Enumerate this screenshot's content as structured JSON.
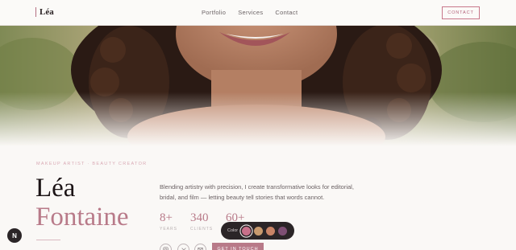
{
  "nav": {
    "logo": "Léa",
    "links": [
      "Portfolio",
      "Services",
      "Contact"
    ],
    "contact_button": "CONTACT"
  },
  "hero": {
    "eyebrow": "MAKEUP ARTIST · BEAUTY CREATOR",
    "first_name": "Léa",
    "last_name": "Fontaine",
    "bio": "Blending artistry with precision, I create transformative looks for editorial, bridal, and film — letting beauty tell stories that words cannot.",
    "stats": [
      {
        "value": "8+",
        "label": "YEARS"
      },
      {
        "value": "340",
        "label": "CLIENTS"
      },
      {
        "value": "60+",
        "label": ""
      }
    ],
    "cta": "GET IN TOUCH",
    "social_icons": [
      "instagram-icon",
      "x-icon",
      "mail-icon"
    ]
  },
  "palette": {
    "label": "Color",
    "swatches": [
      "#c9708a",
      "#c89a6e",
      "#c98466",
      "#7e4f74"
    ],
    "active_index": 0
  },
  "fab": {
    "label": "N"
  }
}
